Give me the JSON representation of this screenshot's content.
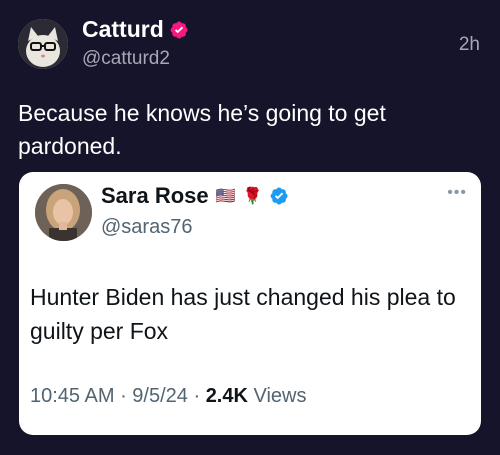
{
  "author": {
    "name": "Catturd",
    "handle": "@catturd2",
    "time": "2h",
    "avatar_icon": "cat-with-glasses-avatar",
    "verified_icon": "verified-badge-icon",
    "verified_color": "#f91880"
  },
  "tweet": {
    "text": "Because he knows he’s going to get pardoned."
  },
  "quoted": {
    "name": "Sara Rose",
    "flag_emoji": "🇺🇸",
    "rose_emoji": "🌹",
    "verified_color": "#1d9bf0",
    "handle": "@saras76",
    "more_label": "•••",
    "text": "Hunter Biden has just changed his plea to guilty per Fox",
    "time": "10:45 AM",
    "sep1": " · ",
    "date": "9/5/24",
    "sep2": " · ",
    "views_count": "2.4K",
    "views_label": " Views"
  },
  "colors": {
    "background": "#15142a",
    "card": "#ffffff",
    "secondary_text": "#a9a7b6"
  }
}
